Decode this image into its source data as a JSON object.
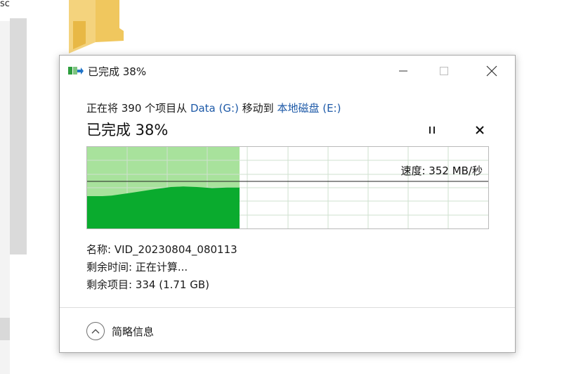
{
  "background": {
    "left_text": "sc"
  },
  "dialog": {
    "title": "已完成 38%",
    "operation": {
      "prefix": "正在将 390 个项目从 ",
      "source": "Data (G:)",
      "middle": " 移动到 ",
      "destination": "本地磁盘 (E:)"
    },
    "progress_text": "已完成 38%",
    "progress_percent": 38,
    "speed_label": "速度: 352 MB/秒",
    "details": {
      "name": "名称: VID_20230804_080113",
      "time_remaining": "剩余时间: 正在计算...",
      "items_remaining": "剩余项目: 334 (1.71 GB)"
    },
    "footer_toggle_label": "简略信息"
  },
  "colors": {
    "progress_fill": "#a8e29c",
    "speed_fill": "#0aab2e",
    "grid_line": "#cfe0cf",
    "link": "#1e5aa8"
  },
  "icons": {
    "app": "file-move-icon",
    "minimize": "minimize-icon",
    "maximize": "maximize-icon",
    "close": "close-icon",
    "pause": "pause-icon",
    "stop": "stop-icon",
    "toggle": "chevron-up-icon"
  }
}
